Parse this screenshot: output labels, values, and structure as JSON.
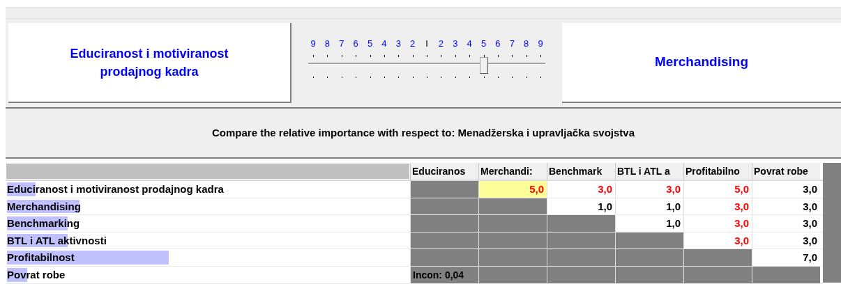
{
  "left_item": {
    "label": "Educiranost i motiviranost prodajnog kadra"
  },
  "scale": {
    "labels": [
      "9",
      "8",
      "7",
      "6",
      "5",
      "4",
      "3",
      "2",
      "I",
      "2",
      "3",
      "4",
      "5",
      "6",
      "7",
      "8",
      "9"
    ],
    "level": 0.75
  },
  "right_item": {
    "label": "Merchandising"
  },
  "prompt": "Compare the relative importance with respect to: Menadžerska i upravljačka svojstva",
  "table": {
    "columns": [
      "Educiranos",
      "Merchandi:",
      "Benchmark",
      "BTL i ATL a",
      "Profitabilno",
      "Povrat robe"
    ],
    "rows": [
      {
        "label": "Educiranost i motiviranost prodajnog kadra",
        "level": 0.07,
        "cells": [
          {
            "kind": "blank"
          },
          {
            "kind": "value",
            "text": "5,0",
            "color": "#ff0000",
            "selected": true
          },
          {
            "kind": "value",
            "text": "3,0",
            "color": "#ff0000",
            "selected": false
          },
          {
            "kind": "value",
            "text": "3,0",
            "color": "#ff0000",
            "selected": false
          },
          {
            "kind": "value",
            "text": "5,0",
            "color": "#ff0000",
            "selected": false
          },
          {
            "kind": "value",
            "text": "3,0",
            "color": "#000000",
            "selected": false
          }
        ]
      },
      {
        "label": "Merchandising",
        "level": 0.18,
        "cells": [
          {
            "kind": "blank"
          },
          {
            "kind": "blank"
          },
          {
            "kind": "value",
            "text": "1,0",
            "color": "#000000",
            "selected": false
          },
          {
            "kind": "value",
            "text": "1,0",
            "color": "#000000",
            "selected": false
          },
          {
            "kind": "value",
            "text": "3,0",
            "color": "#ff0000",
            "selected": false
          },
          {
            "kind": "value",
            "text": "3,0",
            "color": "#000000",
            "selected": false
          }
        ]
      },
      {
        "label": "Benchmarking",
        "level": 0.15,
        "cells": [
          {
            "kind": "blank"
          },
          {
            "kind": "blank"
          },
          {
            "kind": "blank"
          },
          {
            "kind": "value",
            "text": "1,0",
            "color": "#000000",
            "selected": false
          },
          {
            "kind": "value",
            "text": "3,0",
            "color": "#ff0000",
            "selected": false
          },
          {
            "kind": "value",
            "text": "3,0",
            "color": "#000000",
            "selected": false
          }
        ]
      },
      {
        "label": "BTL i ATL aktivnosti",
        "level": 0.15,
        "cells": [
          {
            "kind": "blank"
          },
          {
            "kind": "blank"
          },
          {
            "kind": "blank"
          },
          {
            "kind": "blank"
          },
          {
            "kind": "value",
            "text": "3,0",
            "color": "#ff0000",
            "selected": false
          },
          {
            "kind": "value",
            "text": "3,0",
            "color": "#000000",
            "selected": false
          }
        ]
      },
      {
        "label": "Profitabilnost",
        "level": 0.4,
        "cells": [
          {
            "kind": "blank"
          },
          {
            "kind": "blank"
          },
          {
            "kind": "blank"
          },
          {
            "kind": "blank"
          },
          {
            "kind": "blank"
          },
          {
            "kind": "value",
            "text": "7,0",
            "color": "#000000",
            "selected": false
          }
        ]
      },
      {
        "label": "Povrat robe",
        "level": 0.05,
        "cells": [
          {
            "kind": "note",
            "text": "Incon: 0,04"
          },
          {
            "kind": "blank"
          },
          {
            "kind": "blank"
          },
          {
            "kind": "blank"
          },
          {
            "kind": "blank"
          },
          {
            "kind": "blank"
          }
        ]
      }
    ]
  }
}
